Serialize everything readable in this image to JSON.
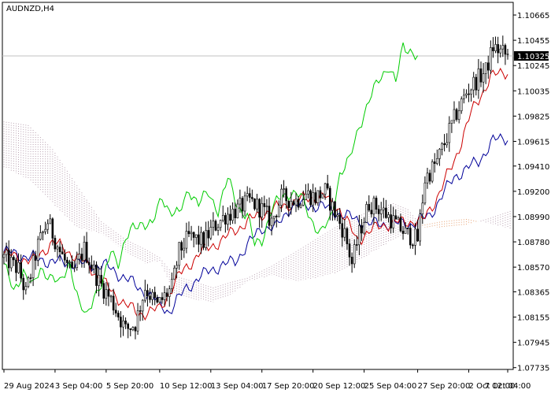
{
  "chart_data": {
    "type": "candlestick",
    "title": "AUDNZD,H4",
    "symbol": "AUDNZD",
    "timeframe": "H4",
    "current_price": "1.10325",
    "price_axis": {
      "min": 1.0772,
      "max": 1.1077,
      "ticks": [
        "1.10665",
        "1.10455",
        "1.10245",
        "1.10035",
        "1.09825",
        "1.09615",
        "1.09410",
        "1.09200",
        "1.08990",
        "1.08780",
        "1.08570",
        "1.08365",
        "1.08155",
        "1.07945",
        "1.07735"
      ]
    },
    "time_axis": {
      "bar_count": 207,
      "labels": [
        {
          "text": "29 Aug 2024",
          "bar": 0
        },
        {
          "text": "3 Sep 04:00",
          "bar": 21
        },
        {
          "text": "5 Sep 20:00",
          "bar": 42
        },
        {
          "text": "10 Sep 12:00",
          "bar": 64
        },
        {
          "text": "13 Sep 04:00",
          "bar": 85
        },
        {
          "text": "17 Sep 20:00",
          "bar": 106
        },
        {
          "text": "20 Sep 12:00",
          "bar": 127
        },
        {
          "text": "25 Sep 04:00",
          "bar": 148
        },
        {
          "text": "27 Sep 20:00",
          "bar": 170
        },
        {
          "text": "2 Oct 12:00",
          "bar": 191
        },
        {
          "text": "7 Oct 04:00",
          "bar": 207
        }
      ]
    },
    "price_path": [
      {
        "bar": 0,
        "price": 1.0865
      },
      {
        "bar": 6,
        "price": 1.0855
      },
      {
        "bar": 9,
        "price": 1.0835
      },
      {
        "bar": 14,
        "price": 1.0875
      },
      {
        "bar": 18,
        "price": 1.0895
      },
      {
        "bar": 23,
        "price": 1.087
      },
      {
        "bar": 28,
        "price": 1.085
      },
      {
        "bar": 33,
        "price": 1.0872
      },
      {
        "bar": 39,
        "price": 1.0845
      },
      {
        "bar": 44,
        "price": 1.083
      },
      {
        "bar": 50,
        "price": 1.0805
      },
      {
        "bar": 54,
        "price": 1.081
      },
      {
        "bar": 58,
        "price": 1.084
      },
      {
        "bar": 63,
        "price": 1.0825
      },
      {
        "bar": 69,
        "price": 1.084
      },
      {
        "bar": 72,
        "price": 1.087
      },
      {
        "bar": 76,
        "price": 1.0882
      },
      {
        "bar": 82,
        "price": 1.0878
      },
      {
        "bar": 86,
        "price": 1.089
      },
      {
        "bar": 91,
        "price": 1.09
      },
      {
        "bar": 96,
        "price": 1.0905
      },
      {
        "bar": 101,
        "price": 1.0912
      },
      {
        "bar": 106,
        "price": 1.0905
      },
      {
        "bar": 110,
        "price": 1.0895
      },
      {
        "bar": 114,
        "price": 1.0915
      },
      {
        "bar": 120,
        "price": 1.0912
      },
      {
        "bar": 124,
        "price": 1.0918
      },
      {
        "bar": 128,
        "price": 1.0915
      },
      {
        "bar": 132,
        "price": 1.092
      },
      {
        "bar": 137,
        "price": 1.0898
      },
      {
        "bar": 140,
        "price": 1.0885
      },
      {
        "bar": 143,
        "price": 1.086
      },
      {
        "bar": 146,
        "price": 1.0885
      },
      {
        "bar": 150,
        "price": 1.091
      },
      {
        "bar": 155,
        "price": 1.0905
      },
      {
        "bar": 160,
        "price": 1.0895
      },
      {
        "bar": 165,
        "price": 1.0885
      },
      {
        "bar": 170,
        "price": 1.088
      },
      {
        "bar": 173,
        "price": 1.093
      },
      {
        "bar": 178,
        "price": 1.0945
      },
      {
        "bar": 182,
        "price": 1.0965
      },
      {
        "bar": 186,
        "price": 1.0985
      },
      {
        "bar": 190,
        "price": 1.1002
      },
      {
        "bar": 194,
        "price": 1.1012
      },
      {
        "bar": 198,
        "price": 1.102
      },
      {
        "bar": 201,
        "price": 1.104
      },
      {
        "bar": 205,
        "price": 1.1035
      },
      {
        "bar": 207,
        "price": 1.1032
      }
    ],
    "indicators": {
      "tenkan_sen": {
        "color": "#cc0000",
        "points": [
          {
            "bar": 0,
            "price": 1.0868
          },
          {
            "bar": 12,
            "price": 1.0862
          },
          {
            "bar": 20,
            "price": 1.0878
          },
          {
            "bar": 28,
            "price": 1.0868
          },
          {
            "bar": 35,
            "price": 1.0858
          },
          {
            "bar": 45,
            "price": 1.0835
          },
          {
            "bar": 55,
            "price": 1.0818
          },
          {
            "bar": 64,
            "price": 1.0822
          },
          {
            "bar": 72,
            "price": 1.085
          },
          {
            "bar": 80,
            "price": 1.0868
          },
          {
            "bar": 90,
            "price": 1.088
          },
          {
            "bar": 100,
            "price": 1.0895
          },
          {
            "bar": 108,
            "price": 1.0903
          },
          {
            "bar": 115,
            "price": 1.0908
          },
          {
            "bar": 125,
            "price": 1.0915
          },
          {
            "bar": 132,
            "price": 1.0915
          },
          {
            "bar": 138,
            "price": 1.0905
          },
          {
            "bar": 145,
            "price": 1.088
          },
          {
            "bar": 155,
            "price": 1.0892
          },
          {
            "bar": 165,
            "price": 1.0895
          },
          {
            "bar": 172,
            "price": 1.0895
          },
          {
            "bar": 178,
            "price": 1.0915
          },
          {
            "bar": 185,
            "price": 1.0945
          },
          {
            "bar": 192,
            "price": 1.0985
          },
          {
            "bar": 200,
            "price": 1.1015
          },
          {
            "bar": 207,
            "price": 1.102
          }
        ]
      },
      "kijun_sen": {
        "color": "#000099",
        "points": [
          {
            "bar": 0,
            "price": 1.087
          },
          {
            "bar": 18,
            "price": 1.0862
          },
          {
            "bar": 30,
            "price": 1.086
          },
          {
            "bar": 42,
            "price": 1.0858
          },
          {
            "bar": 52,
            "price": 1.0845
          },
          {
            "bar": 62,
            "price": 1.083
          },
          {
            "bar": 68,
            "price": 1.082
          },
          {
            "bar": 75,
            "price": 1.084
          },
          {
            "bar": 85,
            "price": 1.0855
          },
          {
            "bar": 95,
            "price": 1.0862
          },
          {
            "bar": 100,
            "price": 1.0875
          },
          {
            "bar": 106,
            "price": 1.089
          },
          {
            "bar": 112,
            "price": 1.089
          },
          {
            "bar": 118,
            "price": 1.0908
          },
          {
            "bar": 130,
            "price": 1.0908
          },
          {
            "bar": 140,
            "price": 1.09
          },
          {
            "bar": 150,
            "price": 1.0893
          },
          {
            "bar": 160,
            "price": 1.0893
          },
          {
            "bar": 168,
            "price": 1.0893
          },
          {
            "bar": 175,
            "price": 1.09
          },
          {
            "bar": 185,
            "price": 1.0932
          },
          {
            "bar": 195,
            "price": 1.0945
          },
          {
            "bar": 201,
            "price": 1.0962
          },
          {
            "bar": 207,
            "price": 1.0965
          }
        ]
      },
      "chikou_span": {
        "color": "#00cc00",
        "points": [
          {
            "bar": 0,
            "price": 1.086
          },
          {
            "bar": 4,
            "price": 1.0835
          },
          {
            "bar": 8,
            "price": 1.0855
          },
          {
            "bar": 12,
            "price": 1.084
          },
          {
            "bar": 15,
            "price": 1.0855
          },
          {
            "bar": 18,
            "price": 1.0852
          },
          {
            "bar": 23,
            "price": 1.0842
          },
          {
            "bar": 27,
            "price": 1.0862
          },
          {
            "bar": 31,
            "price": 1.0825
          },
          {
            "bar": 34,
            "price": 1.0815
          },
          {
            "bar": 37,
            "price": 1.0835
          },
          {
            "bar": 41,
            "price": 1.0845
          },
          {
            "bar": 44,
            "price": 1.087
          },
          {
            "bar": 47,
            "price": 1.0862
          },
          {
            "bar": 50,
            "price": 1.088
          },
          {
            "bar": 53,
            "price": 1.0888
          },
          {
            "bar": 57,
            "price": 1.0895
          },
          {
            "bar": 61,
            "price": 1.0892
          },
          {
            "bar": 65,
            "price": 1.0915
          },
          {
            "bar": 68,
            "price": 1.0905
          },
          {
            "bar": 72,
            "price": 1.09
          },
          {
            "bar": 76,
            "price": 1.0922
          },
          {
            "bar": 80,
            "price": 1.091
          },
          {
            "bar": 84,
            "price": 1.0918
          },
          {
            "bar": 88,
            "price": 1.0905
          },
          {
            "bar": 92,
            "price": 1.093
          },
          {
            "bar": 96,
            "price": 1.0908
          },
          {
            "bar": 100,
            "price": 1.09
          },
          {
            "bar": 103,
            "price": 1.0875
          },
          {
            "bar": 106,
            "price": 1.088
          },
          {
            "bar": 110,
            "price": 1.0905
          },
          {
            "bar": 114,
            "price": 1.0915
          },
          {
            "bar": 118,
            "price": 1.092
          },
          {
            "bar": 122,
            "price": 1.0915
          },
          {
            "bar": 126,
            "price": 1.0898
          },
          {
            "bar": 130,
            "price": 1.0885
          },
          {
            "bar": 134,
            "price": 1.0895
          },
          {
            "bar": 138,
            "price": 1.0935
          },
          {
            "bar": 142,
            "price": 1.0945
          },
          {
            "bar": 146,
            "price": 1.0975
          },
          {
            "bar": 150,
            "price": 1.0995
          },
          {
            "bar": 154,
            "price": 1.1012
          },
          {
            "bar": 158,
            "price": 1.1025
          },
          {
            "bar": 161,
            "price": 1.101
          },
          {
            "bar": 164,
            "price": 1.104
          },
          {
            "bar": 167,
            "price": 1.1038
          },
          {
            "bar": 170,
            "price": 1.1032
          }
        ]
      },
      "kumo_cloud": {
        "points": [
          {
            "bar": 0,
            "a": 1.0978,
            "b": 1.094
          },
          {
            "bar": 10,
            "a": 1.0975,
            "b": 1.093
          },
          {
            "bar": 20,
            "a": 1.0955,
            "b": 1.091
          },
          {
            "bar": 30,
            "a": 1.0925,
            "b": 1.089
          },
          {
            "bar": 40,
            "a": 1.0895,
            "b": 1.0885
          },
          {
            "bar": 50,
            "a": 1.088,
            "b": 1.087
          },
          {
            "bar": 58,
            "a": 1.0872,
            "b": 1.086
          },
          {
            "bar": 64,
            "a": 1.0865,
            "b": 1.0862
          },
          {
            "bar": 70,
            "a": 1.085,
            "b": 1.0835
          },
          {
            "bar": 78,
            "a": 1.0845,
            "b": 1.083
          },
          {
            "bar": 86,
            "a": 1.084,
            "b": 1.0828
          },
          {
            "bar": 94,
            "a": 1.0845,
            "b": 1.0835
          },
          {
            "bar": 100,
            "a": 1.0848,
            "b": 1.0845
          },
          {
            "bar": 110,
            "a": 1.0858,
            "b": 1.085
          },
          {
            "bar": 120,
            "a": 1.087,
            "b": 1.0845
          },
          {
            "bar": 128,
            "a": 1.088,
            "b": 1.0848
          },
          {
            "bar": 136,
            "a": 1.089,
            "b": 1.0852
          },
          {
            "bar": 144,
            "a": 1.0898,
            "b": 1.086
          },
          {
            "bar": 152,
            "a": 1.0905,
            "b": 1.087
          },
          {
            "bar": 160,
            "a": 1.091,
            "b": 1.088
          },
          {
            "bar": 166,
            "a": 1.0905,
            "b": 1.0885
          },
          {
            "bar": 172,
            "a": 1.089,
            "b": 1.0892
          },
          {
            "bar": 180,
            "a": 1.089,
            "b": 1.0895
          },
          {
            "bar": 190,
            "a": 1.0892,
            "b": 1.0897
          },
          {
            "bar": 200,
            "a": 1.0898,
            "b": 1.0893
          },
          {
            "bar": 210,
            "a": 1.0905,
            "b": 1.0888
          },
          {
            "bar": 214,
            "a": 1.0908,
            "b": 1.0885
          }
        ]
      }
    },
    "colors": {
      "candle": "#000000",
      "tenkan": "#cc0000",
      "kijun": "#000099",
      "chikou": "#00cc00",
      "cloud_bear": "#b8a0b0",
      "cloud_bull": "#e6a070",
      "price_line": "#c0c0c0",
      "price_label_bg": "#000000",
      "price_label_text": "#ffffff"
    }
  }
}
